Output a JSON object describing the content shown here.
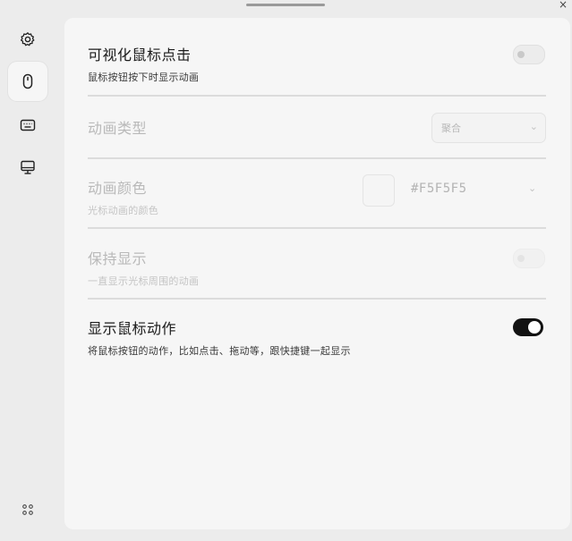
{
  "window": {
    "close_label": "×"
  },
  "sidebar": {
    "items": [
      {
        "name": "settings",
        "icon": "gear-icon",
        "active": false
      },
      {
        "name": "mouse",
        "icon": "mouse-icon",
        "active": true
      },
      {
        "name": "keyboard",
        "icon": "keyboard-icon",
        "active": false
      },
      {
        "name": "display",
        "icon": "monitor-icon",
        "active": false
      }
    ],
    "bottom_icon": "grid-dots-icon"
  },
  "settings": {
    "visualize_click": {
      "title": "可视化鼠标点击",
      "desc": "鼠标按钮按下时显示动画",
      "enabled": false
    },
    "animation_type": {
      "title": "动画类型",
      "value": "聚合"
    },
    "animation_color": {
      "title": "动画颜色",
      "desc": "光标动画的颜色",
      "value": "#F5F5F5"
    },
    "keep_showing": {
      "title": "保持显示",
      "desc": "一直显示光标周围的动画",
      "enabled": false
    },
    "show_mouse_action": {
      "title": "显示鼠标动作",
      "desc": "将鼠标按钮的动作，比如点击、拖动等，跟快捷键一起显示",
      "enabled": true
    }
  },
  "colors": {
    "toggle_on": "#121212",
    "panel": "#f6f6f6",
    "background": "#ececec"
  }
}
